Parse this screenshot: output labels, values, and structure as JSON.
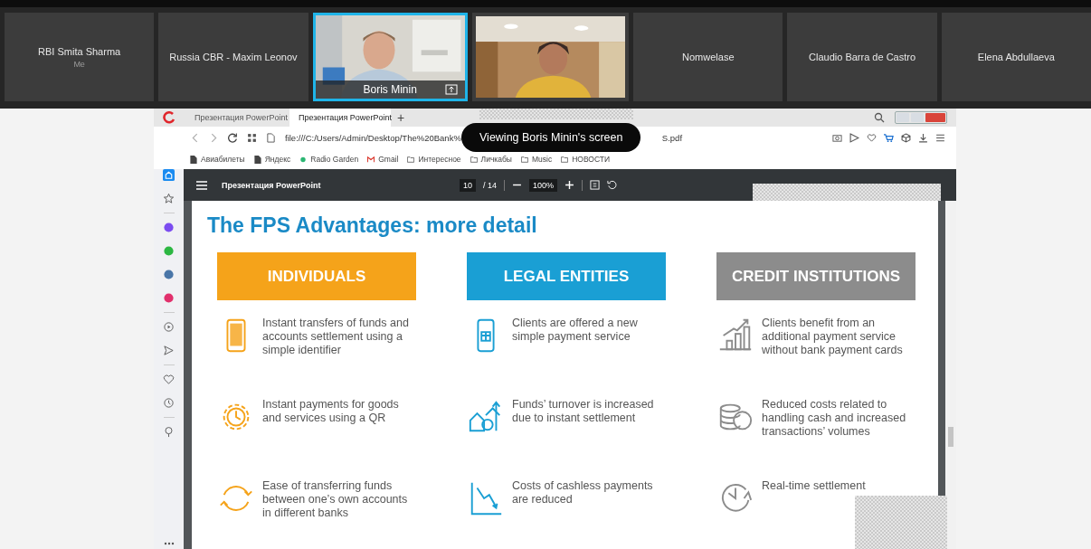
{
  "participants": [
    {
      "kind": "name",
      "name": "RBI Smita Sharma",
      "subtitle": "Me",
      "selected": false
    },
    {
      "kind": "name",
      "name": "Russia CBR - Maxim Leonov",
      "selected": false
    },
    {
      "kind": "video",
      "name": "Boris Minin",
      "selected": true
    },
    {
      "kind": "video",
      "selected": false
    },
    {
      "kind": "name",
      "name": "Nomwelase",
      "selected": false
    },
    {
      "kind": "name",
      "name": "Claudio Barra de Castro",
      "selected": false
    },
    {
      "kind": "name",
      "name": "Elena Abdullaeva",
      "selected": false
    }
  ],
  "banner": "Viewing Boris Minin's screen",
  "browser": {
    "tabs": [
      {
        "title": "Презентация PowerPoint",
        "selected": false
      },
      {
        "title": "Презентация PowerPoint",
        "selected": true
      }
    ],
    "new_tab": "+",
    "address_start": "file:///C:/Users/Admin/Desktop/The%20Bank%",
    "address_end": "S.pdf",
    "bookmarks": [
      {
        "kind": "page",
        "label": "Авиабилеты"
      },
      {
        "kind": "page",
        "label": "Яндекс"
      },
      {
        "kind": "dot",
        "label": "Radio Garden"
      },
      {
        "kind": "mail",
        "label": "Gmail"
      },
      {
        "kind": "folder",
        "label": "Интересное"
      },
      {
        "kind": "folder",
        "label": "Личкабы"
      },
      {
        "kind": "folder",
        "label": "Music"
      },
      {
        "kind": "folder",
        "label": "НОВОСТИ"
      }
    ]
  },
  "pdf_viewer": {
    "title": "Презентация PowerPoint",
    "page": "10",
    "total": "/ 14",
    "zoom": "100%"
  },
  "slide": {
    "title": "The FPS Advantages: more detail",
    "columns": [
      {
        "heading": "INDIVIDUALS",
        "color": "#f5a31a",
        "items": [
          {
            "text": "Instant transfers of funds and accounts settlement using a simple identifier"
          },
          {
            "text": "Instant payments for goods and services using a QR"
          },
          {
            "text": "Ease of transferring funds between one’s own accounts in different banks"
          }
        ]
      },
      {
        "heading": "LEGAL ENTITIES",
        "color": "#1a9fd4",
        "items": [
          {
            "text": "Clients are offered a new simple payment service"
          },
          {
            "text": "Funds’ turnover is increased due to instant settlement"
          },
          {
            "text": "Costs of cashless payments are reduced"
          }
        ]
      },
      {
        "heading": "CREDIT INSTITUTIONS",
        "color": "#8c8c8c",
        "items": [
          {
            "text": "Clients benefit from an additional payment service without bank payment cards"
          },
          {
            "text": "Reduced costs related to handling cash and increased transactions’ volumes"
          },
          {
            "text": "Real-time settlement"
          }
        ]
      }
    ]
  }
}
